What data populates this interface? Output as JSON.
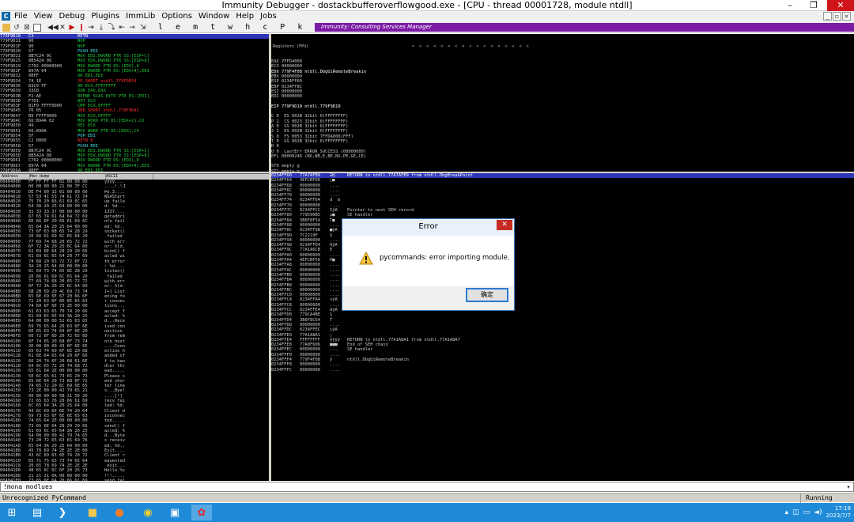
{
  "window": {
    "title": "Immunity Debugger - dostackbufferoverflowgood.exe - [CPU - thread 00001728, module ntdll]",
    "min": "–",
    "max": "❐",
    "close": "✕"
  },
  "menu": {
    "app_icon": "C",
    "items": [
      "File",
      "View",
      "Debug",
      "Plugins",
      "ImmLib",
      "Options",
      "Window",
      "Help",
      "Jobs"
    ],
    "mdi": [
      "_",
      "▫",
      "×"
    ]
  },
  "toolbar": {
    "icons": [
      "folder-open-icon",
      "restart-icon",
      "close-icon",
      "window-icon",
      "rewind-icon",
      "pause-icon",
      "play-icon",
      "step-into-icon",
      "step-over-icon",
      "trace-into-icon",
      "trace-over-icon",
      "execute-till-return-icon",
      "go-to-icon"
    ],
    "letters": "l e m t w h c P k b z r ... s ?",
    "banner": "Immunity: Consulting Services Manager"
  },
  "cpu": {
    "rows": [
      [
        "779F9D10",
        "C3",
        "RETN"
      ],
      [
        "779F9D11",
        "90",
        "NOP"
      ],
      [
        "779F9D1F",
        "90",
        "NOP"
      ],
      [
        "779F9D20",
        "57",
        "PUSH EDI"
      ],
      [
        "779F9D21",
        "8B7C24 0C",
        "MOV EDI,DWORD PTR SS:[ESP+C]"
      ],
      [
        "779F9D25",
        "8B5424 08",
        "MOV EDX,DWORD PTR SS:[ESP+8]"
      ],
      [
        "779F9D29",
        "C702 00000000",
        "MOV DWORD PTR DS:[EDX],0"
      ],
      [
        "779F9D2F",
        "897A 04",
        "MOV DWORD PTR DS:[EDX+4],EDI"
      ],
      [
        "779F9D32",
        "0BFF",
        "OR EDI,EDI"
      ],
      [
        "779F9D34",
        "74 1E",
        "JE SHORT ntdll.779F9D54"
      ],
      [
        "779F9D36",
        "83C9 FF",
        "OR ECX,FFFFFFFF"
      ],
      [
        "779F9D39",
        "33C0",
        "XOR EAX,EAX"
      ],
      [
        "779F9D3B",
        "F2:AE",
        "REPNE SCAS BYTE PTR ES:[EDI]"
      ],
      [
        "779F9D3D",
        "F7D1",
        "NOT ECX"
      ],
      [
        "779F9D3F",
        "81F9 FFFF0000",
        "CMP ECX,0FFFF"
      ],
      [
        "779F9D45",
        "76 05",
        "JBE SHORT ntdll.779F9D4C"
      ],
      [
        "779F9D47",
        "B9 FFFF0000",
        "MOV ECX,0FFFF"
      ],
      [
        "779F9D4C",
        "66:894A 02",
        "MOV WORD PTR DS:[EDX+2],CX"
      ],
      [
        "779F9D50",
        "49",
        "DEC ECX"
      ],
      [
        "779F9D51",
        "66:890A",
        "MOV WORD PTR DS:[EDX],CX"
      ],
      [
        "779F9D54",
        "5F",
        "POP EDI"
      ],
      [
        "779F9D55",
        "C2 0800",
        "RETN 8"
      ],
      [
        "779F9D58",
        "57",
        "PUSH EDI"
      ],
      [
        "779F9D59",
        "8B7C24 0C",
        "MOV EDI,DWORD PTR SS:[ESP+C]"
      ],
      [
        "779F9D5D",
        "8B5424 08",
        "MOV EDX,DWORD PTR SS:[ESP+8]"
      ],
      [
        "779F9D61",
        "C702 00000000",
        "MOV DWORD PTR DS:[EDX],0"
      ],
      [
        "779F9D67",
        "897A 04",
        "MOV DWORD PTR DS:[EDX+4],EDI"
      ],
      [
        "779F9D6A",
        "0BFF",
        "OR EDI,EDI"
      ],
      [
        "779F9D6C",
        "74 1E",
        "JE SHORT ntdll.779F9D8C"
      ],
      [
        "779F9D6E",
        "83C9 FF",
        "OR ECX,FFFFFFFF"
      ]
    ]
  },
  "regs": {
    "header": "Registers (FPU)",
    "arrows": "<  <  <  <  <  <  <  <  <  <  <  <  <  <  <  <  <",
    "lines": [
      "EAX 7FFD4000",
      "ECX 00000000",
      "EDX 779F4F08 ntdll.DbgUiRemoteBreakin",
      "EBX 00000000",
      "ESP 0234FF60",
      "EBP 0234FF8C",
      "ESI 00000000",
      "EDI 00000000",
      "",
      "EIP 779F9D10 ntdll.779F9D10",
      "",
      "C 0  ES 002B 32bit 0(FFFFFFFF)",
      "P 1  CS 0023 32bit 0(FFFFFFFF)",
      "A 0  SS 002B 32bit 0(FFFFFFFF)",
      "Z 1  DS 002B 32bit 0(FFFFFFFF)",
      "S 0  FS 0053 32bit 7FFDA000(FFF)",
      "T 0  GS 002B 32bit 0(FFFFFFFF)",
      "D 0",
      "O 0  LastErr ERROR_SUCCESS (00000000)",
      "EFL 00000246 (NO,NB,E,BE,NS,PE,GE,LE)",
      "",
      "ST0 empty g",
      "ST1 empty g",
      "ST2 empty g",
      "ST3 empty g",
      "ST4 empty g",
      "ST5 empty g",
      "ST6 empty g",
      "ST7 empty g",
      "                3 2 1 0      E S P U O Z D I"
    ]
  },
  "dump": {
    "headers": [
      "Address",
      "Hex dump",
      "ASCII"
    ],
    "rows": [
      [
        "00404000",
        "FF FF FF FF 01 00 00 00",
        "ÿÿÿÿ...."
      ],
      [
        "00404008",
        "00 00 00 00 21 00 7F CC",
        "....!.␡Ì"
      ],
      [
        "00404010",
        "DE F4 00 33 01 00 00 00",
        "Þô.3...."
      ],
      [
        "00404018",
        "57 53 41 53 74 61 72 74",
        "WSAStart"
      ],
      [
        "00404020",
        "75 70 20 66 61 69 6C 65",
        "up faile"
      ],
      [
        "00404028",
        "64 3A 20 25 64 00 00 00",
        "d: %d..."
      ],
      [
        "00404030",
        "31 33 33 37 00 00 00 00",
        "1337...."
      ],
      [
        "00404038",
        "67 65 74 61 64 64 72 69",
        "getaddri"
      ],
      [
        "00404040",
        "6E 66 6F 20 66 61 69 6C",
        "nfo fail"
      ],
      [
        "00404048",
        "65 64 3A 20 25 64 00 00",
        "ed: %d.."
      ],
      [
        "00404050",
        "73 6F 63 6B 65 74 28 29",
        "socket()"
      ],
      [
        "00404058",
        "20 66 61 69 6C 65 64 20",
        " failed "
      ],
      [
        "00404060",
        "77 69 74 68 20 65 72 72",
        "with err"
      ],
      [
        "00404068",
        "6F 72 3A 20 25 6C 64 00",
        "or: %ld."
      ],
      [
        "00404070",
        "62 69 6E 64 28 29 20 66",
        "bind() f"
      ],
      [
        "00404078",
        "61 69 6C 65 64 20 77 69",
        "ailed wi"
      ],
      [
        "00404080",
        "74 68 20 65 72 72 6F 72",
        "th error"
      ],
      [
        "00404088",
        "3A 20 25 64 00 00 00 00",
        ": %d...."
      ],
      [
        "00404090",
        "6C 69 73 74 65 6E 28 29",
        "listen()"
      ],
      [
        "00404098",
        "20 66 61 69 6C 65 64 20",
        " failed "
      ],
      [
        "004040A0",
        "77 69 74 68 20 65 72 72",
        "with err"
      ],
      [
        "004040A8",
        "6F 72 3A 20 25 6C 64 00",
        "or: %ld."
      ],
      [
        "004040B0",
        "5B 2B 5D 20 4C 69 73 74",
        "[+] List"
      ],
      [
        "004040B8",
        "65 6E 69 6E 67 20 66 6F",
        "ening fo"
      ],
      [
        "004040C0",
        "72 20 63 6F 6E 6E 65 63",
        "r connec"
      ],
      [
        "004040C8",
        "74 69 6F 6E 73 2E 00 00",
        "tions..."
      ],
      [
        "004040D0",
        "61 63 63 65 70 74 20 66",
        "accept f"
      ],
      [
        "004040D8",
        "61 69 6C 65 64 3A 20 25",
        "ailed: %"
      ],
      [
        "004040E0",
        "64 00 00 00 52 65 63 65",
        "d...Rece"
      ],
      [
        "004040E8",
        "69 76 65 64 20 63 6F 6E",
        "ived con"
      ],
      [
        "004040F0",
        "6E 65 63 74 69 6F 6E 20",
        "nection "
      ],
      [
        "004040F8",
        "66 72 6F 6D 20 72 65 6D",
        "from rem"
      ],
      [
        "00404100",
        "6F 74 65 20 68 6F 73 74",
        "ote host"
      ],
      [
        "00404108",
        "2E 00 00 00 43 6F 6E 6E",
        "....Conn"
      ],
      [
        "00404110",
        "65 63 74 69 6F 6E 20 68",
        "ection h"
      ],
      [
        "00404118",
        "61 6E 64 65 64 20 6F 66",
        "anded of"
      ],
      [
        "00404120",
        "66 20 74 6F 20 68 61 6E",
        "f to han"
      ],
      [
        "00404128",
        "64 6C 65 72 20 74 68 72",
        "dler thr"
      ],
      [
        "00404130",
        "65 61 64 2E 00 00 00 00",
        "ead....."
      ],
      [
        "00404138",
        "50 6C 65 61 73 65 20 73",
        "Please s"
      ],
      [
        "00404140",
        "65 6E 64 20 73 68 6F 72",
        "end shor"
      ],
      [
        "00404148",
        "74 65 72 20 6C 69 6E 65",
        "ter line"
      ],
      [
        "00404150",
        "73 2E 00 00 42 79 65 21",
        "s...Bye!"
      ],
      [
        "00404158",
        "00 00 00 00 5B 21 5D 20",
        "....[!] "
      ],
      [
        "00404160",
        "72 65 63 76 20 66 61 69",
        "recv fai"
      ],
      [
        "00404168",
        "6C 65 64 3A 20 25 64 00",
        "led: %d."
      ],
      [
        "00404170",
        "43 6C 69 65 6E 74 20 64",
        "Client d"
      ],
      [
        "00404178",
        "69 73 63 6F 6E 6E 65 63",
        "isconnec"
      ],
      [
        "00404180",
        "74 65 64 2E 00 00 00 00",
        "ted....."
      ],
      [
        "00404188",
        "73 65 6E 64 28 29 20 66",
        "send() f"
      ],
      [
        "00404190",
        "61 69 6C 65 64 3A 20 25",
        "ailed: %"
      ],
      [
        "00404198",
        "64 00 00 00 42 79 74 65",
        "d...Byte"
      ],
      [
        "004041A0",
        "73 20 72 65 63 65 69 76",
        "s receiv"
      ],
      [
        "004041A8",
        "65 64 3A 20 25 64 00 00",
        "ed: %d.."
      ],
      [
        "004041B0",
        "45 78 69 74 2E 2E 2E 00",
        "Exit...."
      ],
      [
        "004041B8",
        "43 6C 69 65 6E 74 20 72",
        "Client r"
      ],
      [
        "004041C0",
        "65 71 75 65 73 74 65 64",
        "equested"
      ],
      [
        "004041C8",
        "20 65 78 69 74 2E 2E 2E",
        " exit..."
      ],
      [
        "004041D0",
        "48 65 6C 6C 6F 20 25 73",
        "Hello %s"
      ],
      [
        "004041D8",
        "21 21 21 0A 00 00 00 00",
        "!!!....."
      ],
      [
        "004041E0",
        "73 65 6E 64 20 66 61 69",
        "send fai"
      ]
    ]
  },
  "stack": {
    "rows": [
      [
        "0234FF60",
        "77A7AFB9",
        "ᗱ§",
        "RETURN to ntdll.77A7AFB9 from ntdll.DbgBreakPoint"
      ],
      [
        "0234FF64",
        "4EFCBF00",
        "□■",
        ""
      ],
      [
        "0234FF68",
        "00000000",
        "....",
        ""
      ],
      [
        "0234FF6C",
        "00000000",
        "....",
        ""
      ],
      [
        "0234FF70",
        "00000000",
        "....",
        ""
      ],
      [
        "0234FF74",
        "0234FF64",
        "d  ä",
        ""
      ],
      [
        "0234FF78",
        "00000000",
        "....",
        ""
      ],
      [
        "0234FF7C",
        "0234FFCC",
        "ÌÿĀ",
        "Pointer to next SEH record"
      ],
      [
        "0234FF80",
        "779590B5",
        "µ■",
        "SE handler"
      ],
      [
        "0234FF84",
        "3B6F8F54",
        "T■",
        ""
      ],
      [
        "0234FF88",
        "00000000",
        "....",
        ""
      ],
      [
        "0234FF8C",
        "0234FF98",
        "■ÿĀ",
        ""
      ],
      [
        "0234FF90",
        "7C2219F",
        "§",
        ""
      ],
      [
        "0234FF94",
        "00000000",
        "....",
        ""
      ],
      [
        "0234FF98",
        "0234FFD4",
        "ÔÿĀ",
        ""
      ],
      [
        "0234FF9C",
        "77A1A6CB",
        "Ë",
        ""
      ],
      [
        "0234FFA0",
        "00000000",
        "....",
        ""
      ],
      [
        "0234FFA4",
        "4EFCBF50",
        "P■",
        ""
      ],
      [
        "0234FFA8",
        "00000000",
        "....",
        ""
      ],
      [
        "0234FFAC",
        "00000000",
        "....",
        ""
      ],
      [
        "0234FFB0",
        "00000000",
        "....",
        ""
      ],
      [
        "0234FFB4",
        "00000000",
        "....",
        ""
      ],
      [
        "0234FFB8",
        "00000000",
        "....",
        ""
      ],
      [
        "0234FFBC",
        "00000000",
        "....",
        ""
      ],
      [
        "0234FFC0",
        "00000000",
        "....",
        ""
      ],
      [
        "0234FFC4",
        "0234FFA4",
        "¤ÿĀ",
        ""
      ],
      [
        "0234FFC8",
        "00000000",
        "....",
        ""
      ],
      [
        "0234FFCC",
        "0234FFE4",
        "äÿĀ",
        ""
      ],
      [
        "0234FFD0",
        "779CA4BE",
        "¾",
        ""
      ],
      [
        "0234FFD4",
        "3B6F8C54",
        "T",
        ""
      ],
      [
        "0234FFD8",
        "00000000",
        "....",
        ""
      ],
      [
        "0234FFDC",
        "0234FFEC",
        "ìÿĀ",
        ""
      ],
      [
        "0234FFE0",
        "77A1A8A1",
        "¡",
        ""
      ],
      [
        "0234FFE4",
        "FFFFFFFF",
        "ÿÿÿÿ",
        "RETURN to ntdll.77A1A8A1 from ntdll.77A1A8A7"
      ],
      [
        "0234FFE8",
        "77A0F606",
        "■■■",
        "End of SEH chain"
      ],
      [
        "0234FFEC",
        "00000000",
        "....",
        "SE handler"
      ],
      [
        "0234FFF0",
        "00000000",
        "....",
        ""
      ],
      [
        "0234FFF4",
        "779F4F08",
        "ÿ",
        "ntdll.DbgUiRemoteBreakin"
      ],
      [
        "0234FFF8",
        "00000000",
        "....",
        ""
      ],
      [
        "0234FFFC",
        "00000000",
        "....",
        ""
      ]
    ]
  },
  "dialog": {
    "title": "Error",
    "close": "✕",
    "message": "pycommands: error importing module.",
    "ok": "确定"
  },
  "command": {
    "text": "!mona modlues",
    "dropdown": "▾"
  },
  "status": {
    "message": "Unrecognized PyCommand",
    "state": "Running"
  },
  "taskbar": {
    "apps": [
      "windows-start-icon",
      "file-explorer-icon",
      "powershell-icon",
      "folder-icon",
      "firefox-icon",
      "chrome-icon",
      "remote-icon",
      "immunity-icon"
    ],
    "tray": [
      "up-arrow-icon",
      "network-icon",
      "monitor-icon",
      "speaker-icon"
    ],
    "time": "17:19",
    "date": "2023/7/7"
  },
  "colors": {
    "selection": "#2c35b6",
    "banner": "#7b1aa4",
    "taskbar": "#1f8bd8",
    "dialog_border": "#3a78c0"
  }
}
